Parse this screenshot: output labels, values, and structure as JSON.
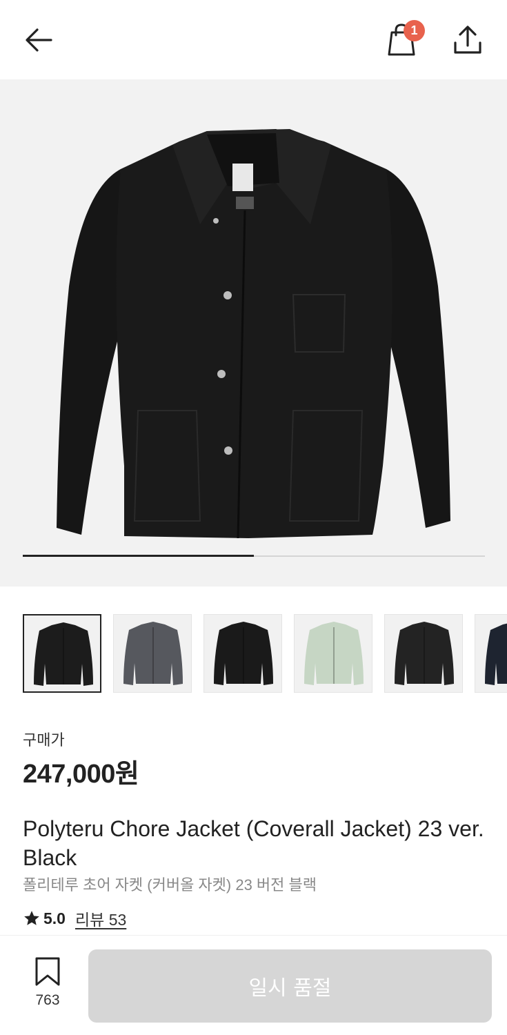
{
  "header": {
    "back_icon": "arrow-left-icon",
    "cart_icon": "shopping-bag-icon",
    "cart_count": "1",
    "share_icon": "share-upload-icon"
  },
  "gallery": {
    "progress": 0.5,
    "thumbnail_count": 6,
    "thumbnail_colors": [
      "#1c1c1c",
      "#56585e",
      "#1a1a1a",
      "#c6d6c4",
      "#232323",
      "#1e2430"
    ]
  },
  "price": {
    "label": "구매가",
    "value": "247,000원"
  },
  "product": {
    "title": "Polyteru Chore Jacket (Coverall Jacket) 23 ver. Black",
    "subtitle": "폴리테루 초어 자켓 (커버올 자켓) 23 버전 블랙",
    "rating": "5.0",
    "review_link": "리뷰 53"
  },
  "bottom": {
    "bookmark_count": "763",
    "cta_label": "일시 품절",
    "cta_color": "#d6d6d6"
  }
}
